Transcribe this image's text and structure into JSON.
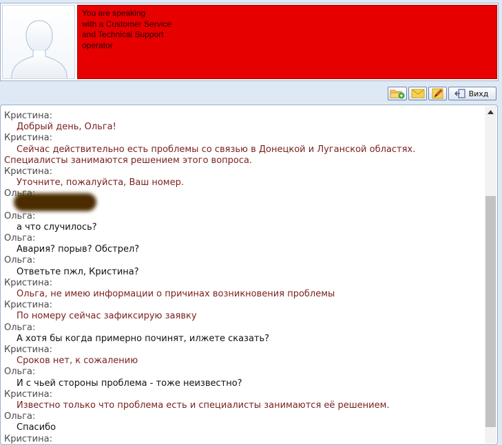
{
  "banner": {
    "operator_message_lines": [
      "You are speaking",
      "with a Customer Service",
      "and Technical Support",
      "operator"
    ]
  },
  "toolbar": {
    "buttons": [
      {
        "icon": "folder-add-icon"
      },
      {
        "icon": "envelope-icon"
      },
      {
        "icon": "pen-icon"
      }
    ],
    "exit_label": "Вихд"
  },
  "chat": {
    "messages": [
      {
        "author": "Кристина:",
        "role": "operator",
        "lines": [
          "Добрый день, Ольга!"
        ]
      },
      {
        "author": "Кристина:",
        "role": "operator",
        "lines": [
          "Сейчас действительно есть проблемы со связью в Донецкой и Луганской областях.",
          "Специалисты занимаются решением этого вопроса."
        ]
      },
      {
        "author": "Кристина:",
        "role": "operator",
        "lines": [
          "Уточните, пожалуйста, Ваш номер."
        ]
      },
      {
        "author": "Ольга:",
        "role": "user",
        "blurred": true,
        "lines": []
      },
      {
        "author": "Ольга:",
        "role": "user",
        "lines": [
          "а что случилось?"
        ]
      },
      {
        "author": "Ольга:",
        "role": "user",
        "lines": [
          "Авария? порыв? Обстрел?"
        ]
      },
      {
        "author": "Ольга:",
        "role": "user",
        "lines": [
          "Ответьте пжл, Кристина?"
        ]
      },
      {
        "author": "Кристина:",
        "role": "operator",
        "lines": [
          "Ольга, не имею информации о причинах возникновения проблемы"
        ]
      },
      {
        "author": "Кристина:",
        "role": "operator",
        "lines": [
          "По номеру сейчас зафиксирую заявку"
        ]
      },
      {
        "author": "Ольга:",
        "role": "user",
        "lines": [
          "А хотя бы когда примерно починят, илжете сказать?"
        ]
      },
      {
        "author": "Кристина:",
        "role": "operator",
        "lines": [
          "Сроков нет, к сожалению"
        ]
      },
      {
        "author": "Ольга:",
        "role": "user",
        "lines": [
          "И с чьей стороны проблема - тоже неизвестно?"
        ]
      },
      {
        "author": "Кристина:",
        "role": "operator",
        "lines": [
          "Известно только что проблема есть и специалисты занимаются её решением."
        ]
      },
      {
        "author": "Ольга:",
        "role": "user",
        "lines": [
          "Спасибо"
        ]
      },
      {
        "author": "Кристина:",
        "role": "operator",
        "lines": []
      }
    ]
  },
  "colors": {
    "banner_red": "#e60000",
    "operator_text": "#7a1e1e",
    "user_text": "#111111",
    "author_text": "#4a4a4a"
  }
}
